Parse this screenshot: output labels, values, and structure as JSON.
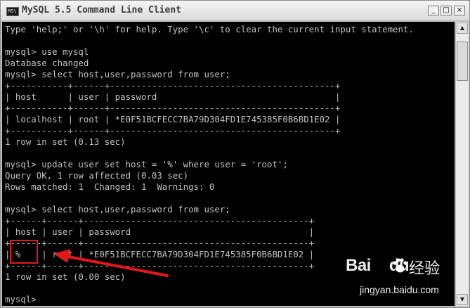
{
  "window": {
    "title": "MySQL 5.5 Command Line Client",
    "buttons": {
      "minimize": "_",
      "maximize": "□",
      "close": "×"
    }
  },
  "console": {
    "lines": [
      "Type 'help;' or '\\h' for help. Type '\\c' to clear the current input statement.",
      "",
      "mysql> use mysql",
      "Database changed",
      "mysql> select host,user,password from user;",
      "+-----------+------+-------------------------------------------+",
      "| host      | user | password                                  |",
      "+-----------+------+-------------------------------------------+",
      "| localhost | root | *E0F51BCFECC7BA79D304FD1E745385F0B6BD1E02 |",
      "+-----------+------+-------------------------------------------+",
      "1 row in set (0.13 sec)",
      "",
      "mysql> update user set host = '%' where user = 'root';",
      "Query OK, 1 row affected (0.03 sec)",
      "Rows matched: 1  Changed: 1  Warnings: 0",
      "",
      "mysql> select host,user,password from user;",
      "+------+------+-------------------------------------------+",
      "| host | user | password                                  |",
      "+------+------+-------------------------------------------+",
      "| %    | root | *E0F51BCFECC7BA79D304FD1E745385F0B6BD1E02 |",
      "+------+------+-------------------------------------------+",
      "1 row in set (0.00 sec)",
      "",
      "mysql>"
    ]
  },
  "scrollbar": {
    "up": "▲",
    "down": "▼"
  },
  "annotation": {
    "color": "#e01818"
  },
  "watermark": {
    "brand": "Bai",
    "brand2": "du",
    "cn": "经验",
    "url": "jingyan.baidu.com"
  }
}
